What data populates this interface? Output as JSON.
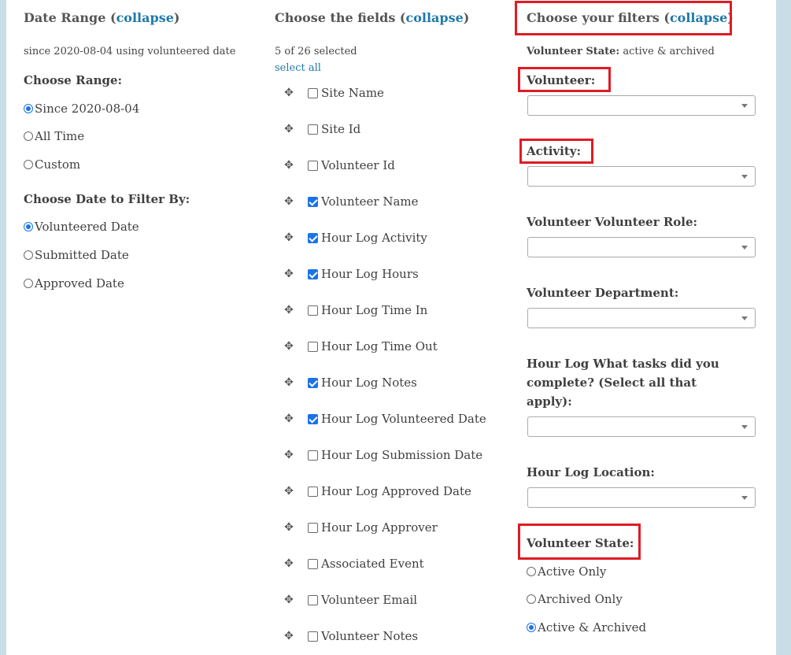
{
  "date_range": {
    "title": "Date Range",
    "collapse": "collapse",
    "summary": "since 2020-08-04 using volunteered date",
    "choose_range_label": "Choose Range:",
    "range_options": [
      {
        "label": "Since 2020-08-04",
        "selected": true
      },
      {
        "label": "All Time",
        "selected": false
      },
      {
        "label": "Custom",
        "selected": false
      }
    ],
    "filter_by_label": "Choose Date to Filter By:",
    "filter_by_options": [
      {
        "label": "Volunteered Date",
        "selected": true
      },
      {
        "label": "Submitted Date",
        "selected": false
      },
      {
        "label": "Approved Date",
        "selected": false
      }
    ]
  },
  "fields": {
    "title": "Choose the fields",
    "collapse": "collapse",
    "count": "5 of 26 selected",
    "select_all": "select all",
    "items": [
      {
        "label": "Site Name",
        "checked": false
      },
      {
        "label": "Site Id",
        "checked": false
      },
      {
        "label": "Volunteer Id",
        "checked": false
      },
      {
        "label": "Volunteer Name",
        "checked": true
      },
      {
        "label": "Hour Log Activity",
        "checked": true
      },
      {
        "label": "Hour Log Hours",
        "checked": true
      },
      {
        "label": "Hour Log Time In",
        "checked": false
      },
      {
        "label": "Hour Log Time Out",
        "checked": false
      },
      {
        "label": "Hour Log Notes",
        "checked": true
      },
      {
        "label": "Hour Log Volunteered Date",
        "checked": true
      },
      {
        "label": "Hour Log Submission Date",
        "checked": false
      },
      {
        "label": "Hour Log Approved Date",
        "checked": false
      },
      {
        "label": "Hour Log Approver",
        "checked": false
      },
      {
        "label": "Associated Event",
        "checked": false
      },
      {
        "label": "Volunteer Email",
        "checked": false
      },
      {
        "label": "Volunteer Notes",
        "checked": false
      }
    ],
    "drag_icon": "move-handle-icon"
  },
  "filters": {
    "title": "Choose your filters",
    "collapse": "collapse",
    "state_summary_label": "Volunteer State:",
    "state_summary_value": "active & archived",
    "volunteer_label": "Volunteer:",
    "activity_label": "Activity:",
    "role_label": "Volunteer Volunteer Role:",
    "department_label": "Volunteer Department:",
    "tasks_label": "Hour Log What tasks did you complete? (Select all that apply):",
    "location_label": "Hour Log Location:",
    "state_label": "Volunteer State:",
    "state_options": [
      {
        "label": "Active Only",
        "selected": false
      },
      {
        "label": "Archived Only",
        "selected": false
      },
      {
        "label": "Active & Archived",
        "selected": true
      }
    ]
  },
  "colors": {
    "accent": "#1f79a8",
    "highlight": "#e01b24",
    "check": "#1a73e8",
    "background": "#c9dde7"
  }
}
